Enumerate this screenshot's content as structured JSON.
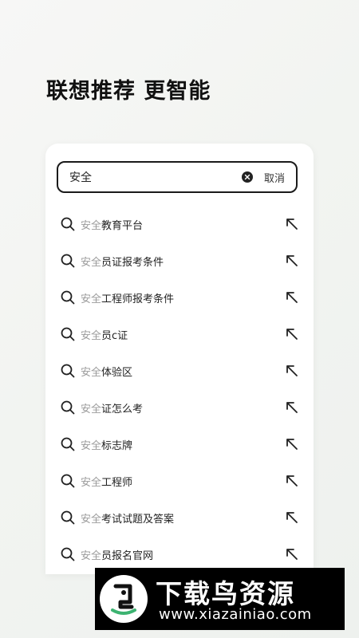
{
  "headline": "联想推荐 更智能",
  "search": {
    "query": "安全",
    "cancel_label": "取消"
  },
  "suggestions": [
    {
      "prefix": "安全",
      "rest": "教育平台"
    },
    {
      "prefix": "安全",
      "rest": "员证报考条件"
    },
    {
      "prefix": "安全",
      "rest": "工程师报考条件"
    },
    {
      "prefix": "安全",
      "rest": "员c证"
    },
    {
      "prefix": "安全",
      "rest": "体验区"
    },
    {
      "prefix": "安全",
      "rest": "证怎么考"
    },
    {
      "prefix": "安全",
      "rest": "标志牌"
    },
    {
      "prefix": "安全",
      "rest": "工程师"
    },
    {
      "prefix": "安全",
      "rest": "考试试题及答案"
    },
    {
      "prefix": "安全",
      "rest": "员报名官网"
    }
  ],
  "watermark": {
    "title": "下载鸟资源",
    "url": "www.xiazainiao.com"
  },
  "colors": {
    "highlight": "#9a9a9a",
    "text": "#222222",
    "border": "#1a1a1a"
  },
  "icons": {
    "search": "search-icon",
    "clear": "clear-icon",
    "fill": "arrow-up-left-icon"
  }
}
